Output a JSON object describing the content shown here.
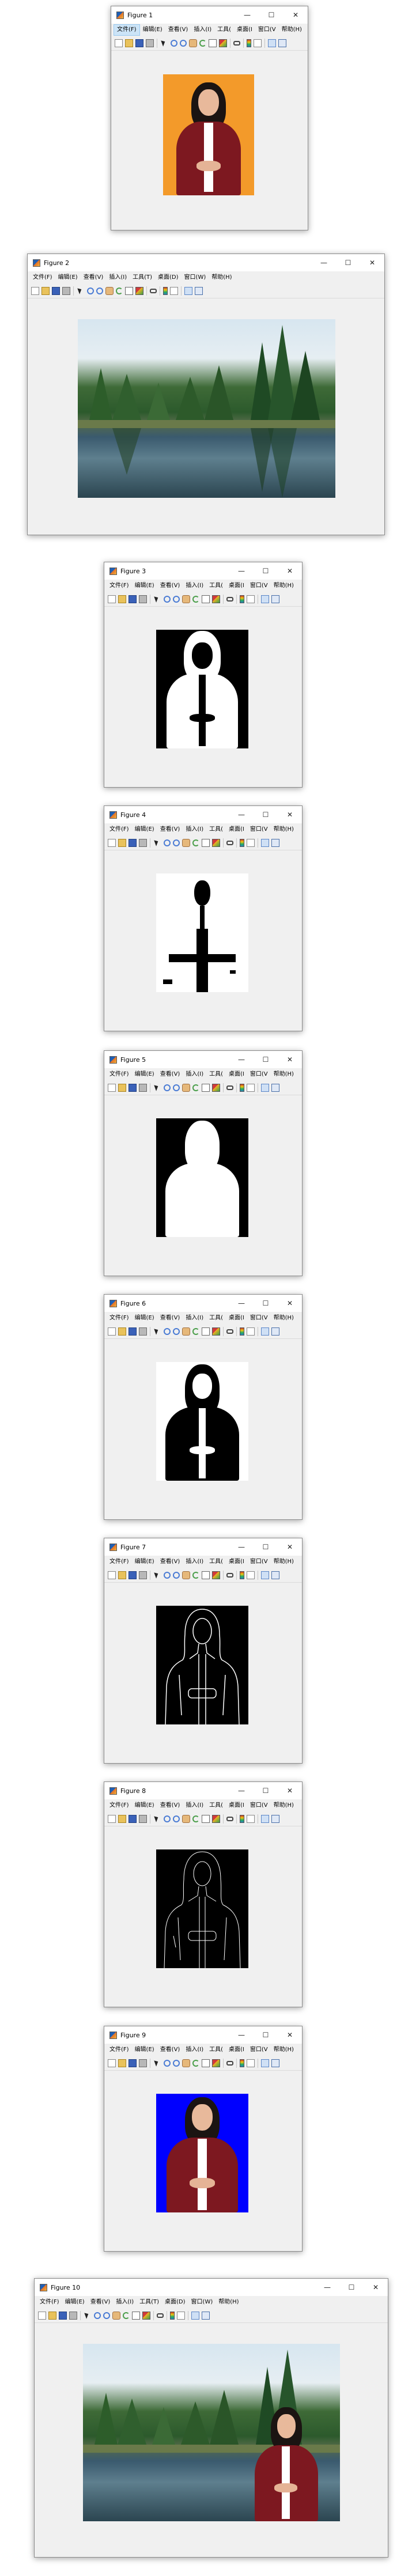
{
  "menus": {
    "full": [
      "文件(F)",
      "编辑(E)",
      "查看(V)",
      "插入(I)",
      "工具(T)",
      "桌面(D)",
      "窗口(W)",
      "帮助(H)"
    ],
    "narrow": [
      "文件(F)",
      "编辑(E)",
      "查看(V)",
      "插入(I)",
      "工具(",
      "桌面(I",
      "窗口(V",
      "帮助(H)"
    ]
  },
  "window_buttons": {
    "minimize": "—",
    "maximize": "☐",
    "close": "✕"
  },
  "toolbar_icons": [
    "new-file-icon",
    "open-folder-icon",
    "save-icon",
    "print-icon",
    "pointer-icon",
    "zoom-in-icon",
    "zoom-out-icon",
    "pan-hand-icon",
    "rotate-3d-icon",
    "data-cursor-icon",
    "brush-icon",
    "link-plot-icon",
    "colorbar-icon",
    "legend-icon",
    "hide-plot-tools-icon",
    "show-plot-tools-icon",
    "dock-icon"
  ],
  "colors": {
    "portrait_background": "#f39a2a",
    "chroma_blue": "#0000ff",
    "figure_bg": "#f0f0f0",
    "active_menu": "#cce4f7"
  },
  "windows": [
    {
      "title": "Figure 1",
      "content": "orange-portrait"
    },
    {
      "title": "Figure 2",
      "content": "lake-landscape"
    },
    {
      "title": "Figure 3",
      "content": "binary-mask-inverted"
    },
    {
      "title": "Figure 4",
      "content": "binary-mask-sparse"
    },
    {
      "title": "Figure 5",
      "content": "binary-silhouette"
    },
    {
      "title": "Figure 6",
      "content": "binary-person-white-bg"
    },
    {
      "title": "Figure 7",
      "content": "edge-outline"
    },
    {
      "title": "Figure 8",
      "content": "edge-outline-thin"
    },
    {
      "title": "Figure 9",
      "content": "blue-portrait"
    },
    {
      "title": "Figure 10",
      "content": "composite"
    }
  ]
}
